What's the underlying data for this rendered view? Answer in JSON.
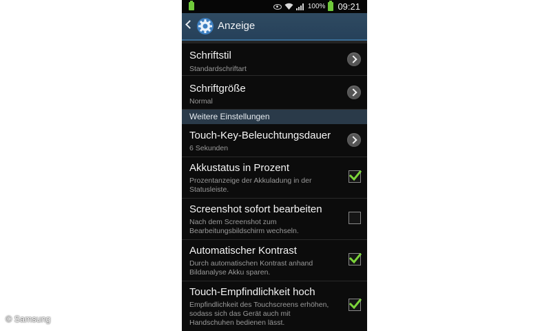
{
  "statusbar": {
    "battery_percent": "100%",
    "time": "09:21"
  },
  "actionbar": {
    "title": "Anzeige"
  },
  "items_top": [
    {
      "title": "Schriftstil",
      "subtitle": "Standardschriftart"
    },
    {
      "title": "Schriftgröße",
      "subtitle": "Normal"
    }
  ],
  "section": {
    "label": "Weitere Einstellungen"
  },
  "touch_key": {
    "title": "Touch-Key-Beleuchtungsdauer",
    "subtitle": "6 Sekunden"
  },
  "toggles": [
    {
      "title": "Akkustatus in Prozent",
      "line1": "Prozentanzeige der Akkuladung in der",
      "line2": "Statusleiste.",
      "checked": true
    },
    {
      "title": "Screenshot sofort bearbeiten",
      "line1": "Nach dem Screenshot zum",
      "line2": "Bearbeitungsbildschirm wechseln.",
      "checked": false
    },
    {
      "title": "Automatischer Kontrast",
      "line1": "Durch automatischen Kontrast anhand",
      "line2": "Bildanalyse Akku sparen.",
      "checked": true
    },
    {
      "title": "Touch-Empfindlichkeit hoch",
      "line1": "Empfindlichkeit des Touchscreens erhöhen,",
      "line2": "sodass sich das Gerät auch mit",
      "line3": "Handschuhen bedienen lässt.",
      "checked": true
    }
  ],
  "copyright": "© Samsung",
  "colors": {
    "check": "#7cd43a",
    "accent": "#3a6d96",
    "section_bg": "#2a3a49"
  }
}
